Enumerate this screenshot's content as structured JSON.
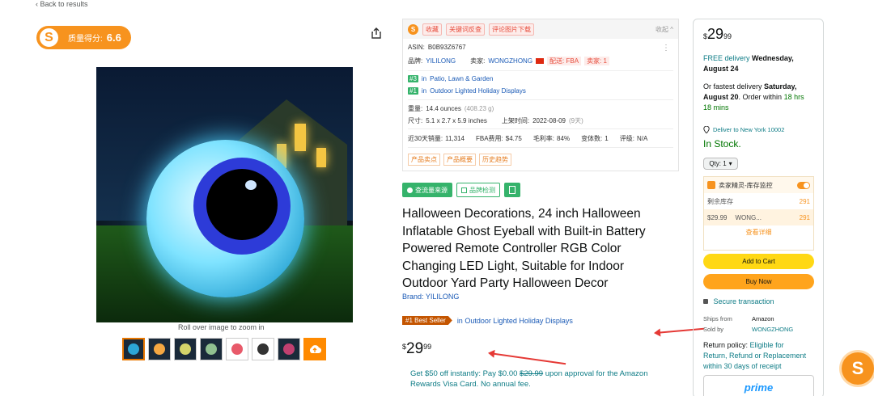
{
  "nav": {
    "back": "‹ Back to results"
  },
  "score": {
    "logo": "S",
    "label": "质量得分:",
    "value": "6.6"
  },
  "gallery": {
    "zoom_hint": "Roll over image to zoom in",
    "thumb_colors": [
      "#2ca6d6",
      "#f4a742",
      "#d4d46a",
      "#90c090",
      "#e85a6a",
      "#f0f0f0",
      "#c04070",
      "#2ca6d6"
    ]
  },
  "plugin": {
    "logo": "S",
    "tags": [
      "收藏",
      "关键词反查",
      "评论图片下载"
    ],
    "collapse": "收起 ^",
    "kebab": "⋮",
    "asin_label": "ASIN:",
    "asin": "B0B93Z6767",
    "brand_label": "品牌:",
    "brand": "YILILONG",
    "seller_label": "卖家:",
    "seller": "WONGZHONG",
    "fulfillment": "配送: FBA",
    "seller_count": "卖家: 1",
    "rank1_tag": "#3",
    "rank1_in": "in",
    "rank1_cat": "Patio, Lawn & Garden",
    "rank2_tag": "#1",
    "rank2_in": "in",
    "rank2_cat": "Outdoor Lighted Holiday Displays",
    "weight_label": "重量:",
    "weight": "14.4 ounces",
    "weight_g": "(408.23 g)",
    "size_label": "尺寸:",
    "size": "5.1 x 2.7 x 5.9 inches",
    "listed_label": "上架时间:",
    "listed": "2022-08-09",
    "listed_days": "(9天)",
    "sales_label": "近30天销量:",
    "sales": "11,314",
    "fba_label": "FBA费用:",
    "fba": "$4.75",
    "margin_label": "毛利率:",
    "margin": "84%",
    "variants_label": "变体数:",
    "variants": "1",
    "rating_label": "评级:",
    "rating": "N/A",
    "bottom_tags": [
      "产品卖点",
      "产品概要",
      "历史趋势"
    ]
  },
  "actions": {
    "source": "查流量来源",
    "brand_check": "品牌检测"
  },
  "product": {
    "title": "Halloween Decorations, 24 inch Halloween Inflatable Ghost Eyeball with Built-in Battery Powered Remote Controller RGB Color Changing LED Light, Suitable for Indoor Outdoor Yard Party Halloween Decor",
    "brand": "Brand: YILILONG",
    "badge": "#1 Best Seller",
    "badge_cat": "in Outdoor Lighted Holiday Displays",
    "price_symbol": "$",
    "price_whole": "29",
    "price_cents": "99",
    "visa_pre": "Get $50 off instantly: Pay $0.00",
    "visa_strike": "$29.99",
    "visa_post": "upon approval for the Amazon Rewards Visa Card. No annual fee."
  },
  "buybox": {
    "price_symbol": "$",
    "price_whole": "29",
    "price_cents": "99",
    "free_delivery": "FREE delivery",
    "delivery_date": "Wednesday,",
    "delivery_date2": "August 24",
    "fastest_pre": "Or fastest delivery",
    "fastest_day": "Saturday,",
    "fastest_date": "August 20",
    "fastest_post": ". Order within",
    "countdown1": "18 hrs",
    "countdown2": "18 mins",
    "location": "Deliver to New York 10002",
    "stock": "In Stock.",
    "qty": "Qty: 1",
    "inv_title": "卖家精灵-库存监控",
    "inv_remaining": "剩余库存",
    "inv_total": "291",
    "inv_price": "$29.99",
    "inv_seller": "WONG...",
    "inv_seller_qty": "291",
    "inv_more": "查看详细",
    "add_to_cart": "Add to Cart",
    "buy_now": "Buy Now",
    "secure": "Secure transaction",
    "ships_from_label": "Ships from",
    "ships_from": "Amazon",
    "sold_by_label": "Sold by",
    "sold_by": "WONGZHONG",
    "return_label": "Return policy:",
    "return_link": "Eligible for",
    "return_link2": "Return, Refund or Replacement",
    "return_link3": "within 30 days of receipt",
    "prime": "prime"
  },
  "float_logo": "S"
}
